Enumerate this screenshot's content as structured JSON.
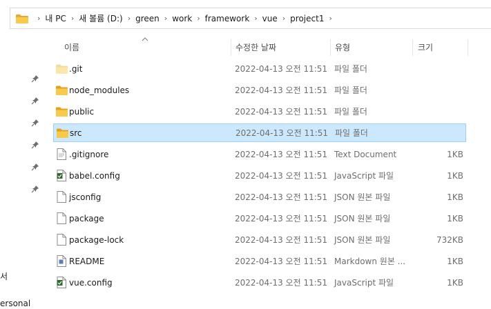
{
  "breadcrumb": [
    "내 PC",
    "새 볼륨 (D:)",
    "green",
    "work",
    "framework",
    "vue",
    "project1"
  ],
  "columns": {
    "name": "이름",
    "date": "수정한 날짜",
    "type": "유형",
    "size": "크기"
  },
  "nav_partial": [
    "서",
    "ersonal"
  ],
  "files": [
    {
      "name": ".git",
      "date": "2022-04-13 오전 11:51",
      "type": "파일 폴더",
      "size": "",
      "icon": "folder-light-icon",
      "selected": false
    },
    {
      "name": "node_modules",
      "date": "2022-04-13 오전 11:51",
      "type": "파일 폴더",
      "size": "",
      "icon": "folder-icon",
      "selected": false
    },
    {
      "name": "public",
      "date": "2022-04-13 오전 11:51",
      "type": "파일 폴더",
      "size": "",
      "icon": "folder-icon",
      "selected": false
    },
    {
      "name": "src",
      "date": "2022-04-13 오전 11:51",
      "type": "파일 폴더",
      "size": "",
      "icon": "folder-icon",
      "selected": true
    },
    {
      "name": ".gitignore",
      "date": "2022-04-13 오전 11:51",
      "type": "Text Document",
      "size": "1KB",
      "icon": "text-file-icon",
      "selected": false
    },
    {
      "name": "babel.config",
      "date": "2022-04-13 오전 11:51",
      "type": "JavaScript 파일",
      "size": "1KB",
      "icon": "js-file-icon",
      "selected": false
    },
    {
      "name": "jsconfig",
      "date": "2022-04-13 오전 11:51",
      "type": "JSON 원본 파일",
      "size": "1KB",
      "icon": "json-file-icon",
      "selected": false
    },
    {
      "name": "package",
      "date": "2022-04-13 오전 11:51",
      "type": "JSON 원본 파일",
      "size": "1KB",
      "icon": "json-file-icon",
      "selected": false
    },
    {
      "name": "package-lock",
      "date": "2022-04-13 오전 11:51",
      "type": "JSON 원본 파일",
      "size": "732KB",
      "icon": "json-file-icon",
      "selected": false
    },
    {
      "name": "README",
      "date": "2022-04-13 오전 11:51",
      "type": "Markdown 원본 ...",
      "size": "1KB",
      "icon": "markdown-file-icon",
      "selected": false
    },
    {
      "name": "vue.config",
      "date": "2022-04-13 오전 11:51",
      "type": "JavaScript 파일",
      "size": "1KB",
      "icon": "js-file-icon",
      "selected": false
    }
  ],
  "colors": {
    "selected_bg": "#cce8ff",
    "selected_border": "#99d1ff",
    "folder": "#f8c94a"
  }
}
